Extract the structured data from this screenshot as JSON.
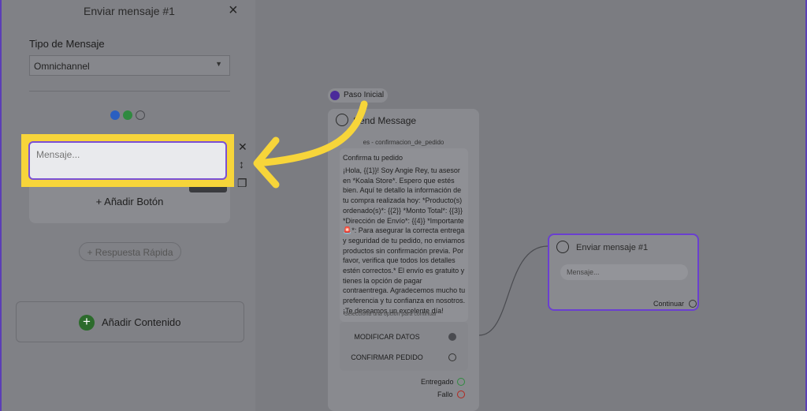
{
  "panel": {
    "title": "Enviar mensaje #1",
    "close_icon": "×",
    "type_label": "Tipo de Mensaje",
    "type_value": "Omnichannel",
    "channels": [
      "messenger-icon",
      "whatsapp-icon",
      "sms-icon"
    ],
    "message_placeholder": "Mensaje...",
    "add_button": "+ Añadir Botón",
    "quick_reply": "+ Respuesta Rápida",
    "add_content": "Añadir Contenido"
  },
  "canvas": {
    "start_label": "Paso Inicial",
    "node1": {
      "title": "Send Message",
      "template": "es - confirmacion_de_pedido",
      "card_title": "Confirma tu pedido",
      "card_body": "¡Hola, {{1}}! Soy Angie Rey, tu asesor en *Koala Store*. Espero que estés bien. Aquí te detallo la información de tu compra realizada hoy: *Producto(s) ordenado(s)*: {{2}} *Monto Total*: {{3}} *Dirección de Envío*: {{4}} *Importante 🚨*: Para asegurar la correcta entrega y seguridad de tu pedido, no enviamos productos sin confirmación previa. Por favor, verifica que todos los detalles estén correctos.* El envío es gratuito y tienes la opción de pagar contraentrega. Agradecemos mucho tu preferencia y tu confianza en nosotros. ¡Te deseamos un excelente día!",
      "card_hint": "Selecciona una opción para continuar",
      "options": [
        "MODIFICAR DATOS",
        "CONFIRMAR PEDIDO"
      ],
      "outputs": [
        "Entregado",
        "Fallo"
      ]
    },
    "node2": {
      "title": "Enviar mensaje #1",
      "input_placeholder": "Mensaje...",
      "continue_label": "Continuar"
    }
  },
  "colors": {
    "highlight": "#f7d53a",
    "accent": "#6a3fd0",
    "success": "#2f8a3f",
    "danger": "#b3261e"
  }
}
